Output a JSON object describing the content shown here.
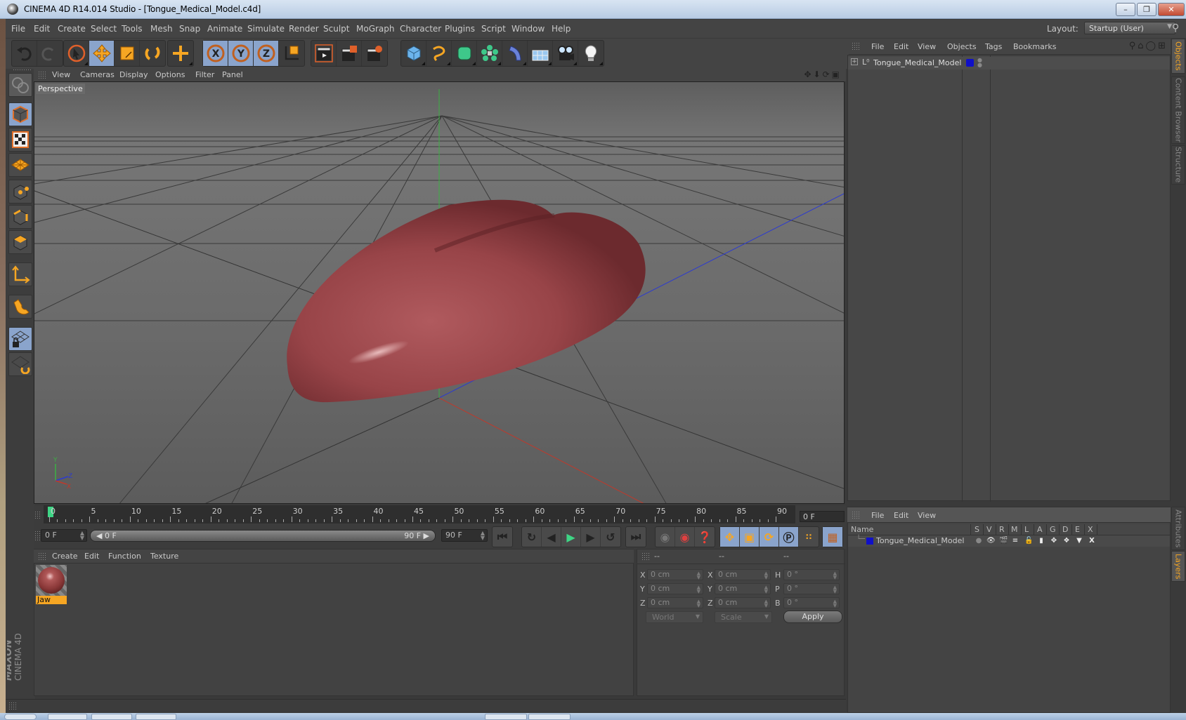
{
  "window": {
    "title": "CINEMA 4D R14.014 Studio - [Tongue_Medical_Model.c4d]",
    "buttons": [
      "minimize",
      "restore",
      "close"
    ]
  },
  "menubar": {
    "items": [
      "File",
      "Edit",
      "Create",
      "Select",
      "Tools",
      "Mesh",
      "Snap",
      "Animate",
      "Simulate",
      "Render",
      "Sculpt",
      "MoGraph",
      "Character",
      "Plugins",
      "Script",
      "Window",
      "Help"
    ],
    "layout_label": "Layout:",
    "layout_value": "Startup (User)"
  },
  "toolbar": {
    "groups": [
      {
        "name": "history",
        "tools": [
          {
            "icon": "undo-icon",
            "active": false
          },
          {
            "icon": "redo-icon",
            "active": false
          }
        ]
      },
      {
        "name": "transform",
        "tools": [
          {
            "icon": "live-selection-icon",
            "active": false
          },
          {
            "icon": "move-icon",
            "active": true
          },
          {
            "icon": "scale-icon",
            "active": false
          },
          {
            "icon": "rotate-icon",
            "active": false
          }
        ]
      },
      {
        "name": "recent",
        "tools": [
          {
            "icon": "recent-tool-icon",
            "active": false
          }
        ]
      },
      {
        "name": "axes",
        "tools": [
          {
            "icon": "x-axis-icon",
            "label": "X",
            "active": true
          },
          {
            "icon": "y-axis-icon",
            "label": "Y",
            "active": true
          },
          {
            "icon": "z-axis-icon",
            "label": "Z",
            "active": true
          },
          {
            "icon": "coordinate-system-icon",
            "active": false
          }
        ]
      },
      {
        "name": "render",
        "tools": [
          {
            "icon": "render-view-icon",
            "active": false
          },
          {
            "icon": "render-picture-viewer-icon",
            "active": false
          },
          {
            "icon": "render-settings-icon",
            "active": false
          }
        ]
      },
      {
        "name": "objects",
        "tools": [
          {
            "icon": "cube-icon",
            "active": false
          },
          {
            "icon": "spline-pen-icon",
            "active": false
          },
          {
            "icon": "subdivision-surface-icon",
            "active": false
          },
          {
            "icon": "array-icon",
            "active": false
          },
          {
            "icon": "deformer-bend-icon",
            "active": false
          },
          {
            "icon": "floor-icon",
            "active": false
          },
          {
            "icon": "camera-icon",
            "active": false
          },
          {
            "icon": "light-icon",
            "active": false
          }
        ]
      }
    ]
  },
  "left_tools": [
    {
      "icon": "make-editable-icon",
      "active": false
    },
    {
      "icon": "model-mode-icon",
      "active": true
    },
    {
      "icon": "texture-mode-icon",
      "active": false
    },
    {
      "icon": "workplane-mode-icon",
      "active": false
    },
    {
      "icon": "points-mode-icon",
      "active": false
    },
    {
      "icon": "edges-mode-icon",
      "active": false
    },
    {
      "icon": "polygons-mode-icon",
      "active": false
    },
    {
      "icon": "axis-mode-icon",
      "active": false
    },
    {
      "icon": "snap-magnet-icon",
      "active": false
    },
    {
      "icon": "locked-workplane-icon",
      "active": true
    },
    {
      "icon": "planar-workplane-icon",
      "active": false
    }
  ],
  "viewport": {
    "menu": [
      "View",
      "Cameras",
      "Display",
      "Options",
      "Filter",
      "Panel"
    ],
    "label": "Perspective",
    "axis_labels": {
      "y": "Y",
      "z": "Z",
      "x": "X"
    },
    "colors": {
      "x_axis": "#c0392b",
      "y_axis": "#3cb043",
      "z_axis": "#2c3ad0",
      "model": "#9a4448"
    }
  },
  "timeline": {
    "ticks": [
      "0",
      "5",
      "10",
      "15",
      "20",
      "25",
      "30",
      "35",
      "40",
      "45",
      "50",
      "55",
      "60",
      "65",
      "70",
      "75",
      "80",
      "85",
      "90"
    ],
    "current_frame": "0 F",
    "start_field": "0 F",
    "range_start": "0 F",
    "range_end": "90 F",
    "end_field": "90 F",
    "playhead_frame": 0,
    "max_frame": 90
  },
  "playback": {
    "buttons": [
      "go-to-start-icon",
      "previous-key-icon",
      "previous-frame-icon",
      "play-icon",
      "next-frame-icon",
      "next-key-icon",
      "go-to-end-icon"
    ],
    "record_buttons": [
      "motion-record-icon",
      "record-active-objects-icon",
      "autokeying-icon"
    ],
    "key_buttons": [
      "record-position-icon",
      "record-scale-icon",
      "record-rotation-icon",
      "record-parameter-icon",
      "record-point-level-icon"
    ],
    "timeline_button": "timeline-icon"
  },
  "material_manager": {
    "menu": [
      "Create",
      "Edit",
      "Function",
      "Texture"
    ],
    "materials": [
      {
        "name": "Jaw"
      }
    ]
  },
  "coordinates": {
    "headers": [
      "--",
      "--",
      "--"
    ],
    "rows": [
      {
        "l1": "X",
        "v1": "0 cm",
        "l2": "X",
        "v2": "0 cm",
        "l3": "H",
        "v3": "0 °"
      },
      {
        "l1": "Y",
        "v1": "0 cm",
        "l2": "Y",
        "v2": "0 cm",
        "l3": "P",
        "v3": "0 °"
      },
      {
        "l1": "Z",
        "v1": "0 cm",
        "l2": "Z",
        "v2": "0 cm",
        "l3": "B",
        "v3": "0 °"
      }
    ],
    "mode_select": "World",
    "size_select": "Scale",
    "apply_label": "Apply"
  },
  "object_manager": {
    "menu": [
      "File",
      "Edit",
      "View",
      "Objects",
      "Tags",
      "Bookmarks"
    ],
    "objects": [
      {
        "name": "Tongue_Medical_Model",
        "layer_color": "#1010c8"
      }
    ]
  },
  "right_tabs_top": [
    {
      "label": "Objects",
      "active": true
    },
    {
      "label": "Content Browser",
      "active": false
    },
    {
      "label": "Structure",
      "active": false
    }
  ],
  "right_tabs_bottom": [
    {
      "label": "Attributes",
      "active": false
    },
    {
      "label": "Layers",
      "active": true
    }
  ],
  "layer_manager": {
    "menu": [
      "File",
      "Edit",
      "View"
    ],
    "columns": [
      "Name",
      "S",
      "V",
      "R",
      "M",
      "L",
      "A",
      "G",
      "D",
      "E",
      "X"
    ],
    "layers": [
      {
        "name": "Tongue_Medical_Model",
        "color": "#1010c8"
      }
    ]
  },
  "branding": {
    "logo_line1": "MAXON",
    "logo_line2": "CINEMA 4D"
  }
}
